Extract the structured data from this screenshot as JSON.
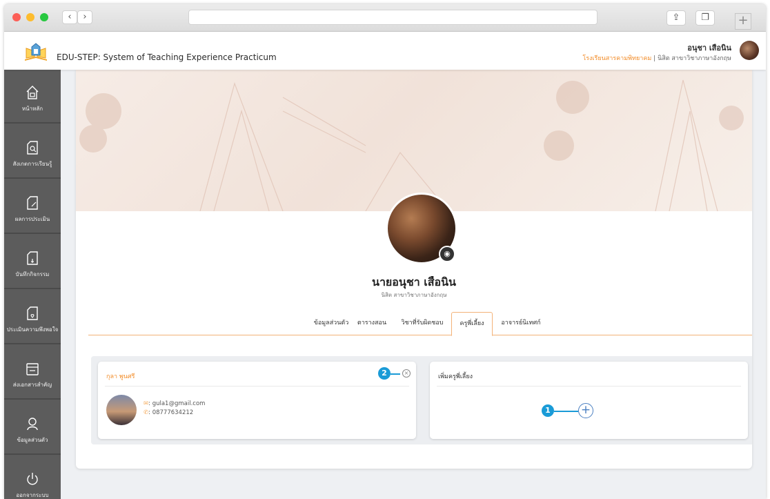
{
  "browser": {
    "back_icon": "‹",
    "forward_icon": "›",
    "share_icon": "⇪",
    "tabs_icon": "❐",
    "newtab_icon": "+"
  },
  "header": {
    "title": "EDU-STEP: System of Teaching Experience Practicum",
    "user_name": "อนุชา เสือนิน",
    "school": "โรงเรียนสารคามพิทยาคม",
    "separator": " | ",
    "user_role": "นิสิต สาขาวิชาภาษาอังกฤษ"
  },
  "sidebar": {
    "items": [
      {
        "label": "หน้าหลัก",
        "icon": "home-icon"
      },
      {
        "label": "สังเกตการเรียนรู้",
        "icon": "observe-doc-icon"
      },
      {
        "label": "ผลการประเมิน",
        "icon": "evaluation-doc-icon"
      },
      {
        "label": "บันทึกกิจกรรม",
        "icon": "activity-doc-icon"
      },
      {
        "label": "ประเมินความพึงพอใจ",
        "icon": "satisfaction-doc-icon"
      },
      {
        "label": "ส่งเอกสารสำคัญ",
        "icon": "submit-doc-icon"
      },
      {
        "label": "ข้อมูลส่วนตัว",
        "icon": "user-icon"
      },
      {
        "label": "ออกจากระบบ",
        "icon": "power-icon"
      }
    ]
  },
  "profile": {
    "name": "นายอนุชา เสือนิน",
    "subtitle": "นิสิต สาขาวิชาภาษาอังกฤษ",
    "camera_icon": "camera-icon"
  },
  "tabs": [
    {
      "label": "ข้อมูลส่วนตัว",
      "active": false
    },
    {
      "label": "ตารางสอน",
      "active": false
    },
    {
      "label": "วิชาที่รับผิดชอบ",
      "active": false
    },
    {
      "label": "ครูพี่เลี้ยง",
      "active": true
    },
    {
      "label": "อาจารย์นิเทศก์",
      "active": false
    }
  ],
  "mentor_card": {
    "name": "กุลา พูนศรี",
    "email_prefix": ": ",
    "email": "gula1@gmail.com",
    "phone_prefix": ": ",
    "phone": "08777634212",
    "close_icon": "×",
    "callout": "2"
  },
  "add_card": {
    "title": "เพิ่มครูพี่เลี้ยง",
    "add_icon": "+",
    "callout": "1"
  },
  "colors": {
    "accent_orange": "#f28c28",
    "sidebar_bg": "#5c5c5c",
    "callout_blue": "#1a9bd7",
    "add_blue": "#4a7fc1"
  }
}
